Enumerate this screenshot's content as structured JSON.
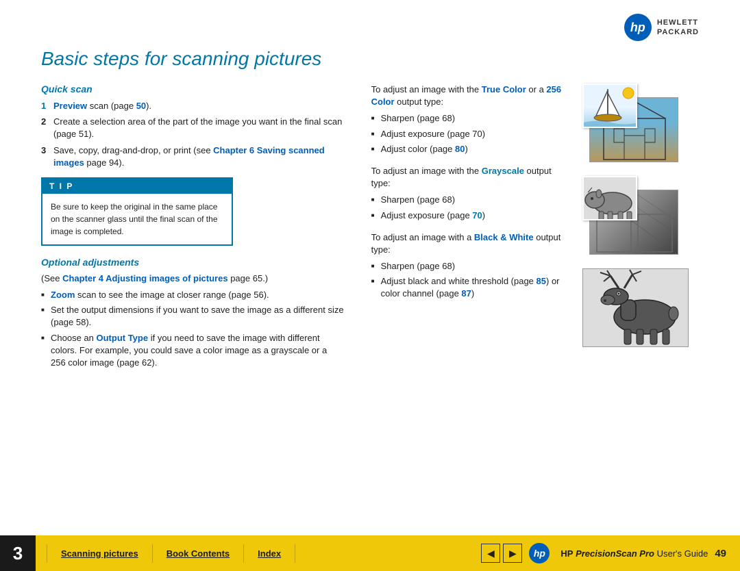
{
  "logo": {
    "circle_text": "hp",
    "line1": "HEWLETT",
    "line2": "PACKARD"
  },
  "title": "Basic steps for scanning pictures",
  "left_col": {
    "quick_scan_heading": "Quick scan",
    "steps": [
      {
        "num": "1",
        "parts": [
          {
            "text": "Preview",
            "style": "bold-blue"
          },
          {
            "text": " scan (page "
          },
          {
            "text": "50",
            "style": "bold-blue"
          },
          {
            "text": ")."
          }
        ]
      },
      {
        "num": "2",
        "text": "Create a selection area of the part of the image you want in the final scan (page 51)."
      },
      {
        "num": "3",
        "parts": [
          {
            "text": "Save, copy, drag-and-drop, or print (see "
          },
          {
            "text": "Chapter 6 Saving scanned images",
            "style": "bold-blue"
          },
          {
            "text": " page 94)."
          }
        ]
      }
    ],
    "tip": {
      "header": "T I P",
      "body": "Be sure to keep the original in the same place on the scanner glass until the final scan of the image is completed."
    },
    "optional_heading": "Optional adjustments",
    "optional_intro_parts": [
      {
        "text": "(See "
      },
      {
        "text": "Chapter 4 Adjusting images of pictures",
        "style": "bold-blue"
      },
      {
        "text": " page 65.)"
      }
    ],
    "optional_bullets": [
      {
        "parts": [
          {
            "text": "Zoom",
            "style": "bold-blue"
          },
          {
            "text": " scan to see the image at closer range (page 56)."
          }
        ]
      },
      {
        "text": "Set the output dimensions if you want to save the image as a different size (page 58)."
      },
      {
        "parts": [
          {
            "text": "Choose an "
          },
          {
            "text": "Output Type",
            "style": "bold-blue"
          },
          {
            "text": " if you need to save the image with different colors. For example, you could save a color image as a grayscale or a 256 color image (page 62)."
          }
        ]
      }
    ]
  },
  "right_col": {
    "sections": [
      {
        "intro": "To adjust an image with the ",
        "color_word": "True Color",
        "color_style": "bold-blue",
        "intro2": " or a ",
        "color_word2": "256 Color",
        "color_style2": "bold-blue",
        "intro3": " output type:",
        "bullets": [
          "Sharpen (page 68)",
          "Adjust exposure (page 70)",
          "Adjust color (page 80)"
        ],
        "page80_style": "bold-blue"
      },
      {
        "intro": "To adjust an image with the ",
        "color_word": "Grayscale",
        "color_style": "bold-teal",
        "intro2": " output type:",
        "bullets": [
          "Sharpen (page 68)",
          "Adjust exposure (page 70)"
        ],
        "page70_style": "bold-teal"
      },
      {
        "intro": "To adjust an image with a ",
        "color_word": "Black & White",
        "color_style": "bold-blue",
        "intro2": " output type:",
        "bullets": [
          "Sharpen (page 68)",
          "Adjust black and white threshold (page 85) or color channel (page 87)"
        ],
        "page85_style": "bold-blue",
        "page87_style": "bold-blue"
      }
    ]
  },
  "footer": {
    "chapter_num": "3",
    "links": [
      "Scanning pictures",
      "Book Contents",
      "Index"
    ],
    "brand_hp": "HP",
    "brand_title": "PrecisionScan Pro",
    "brand_suffix": " User's Guide",
    "page_num": "49"
  }
}
